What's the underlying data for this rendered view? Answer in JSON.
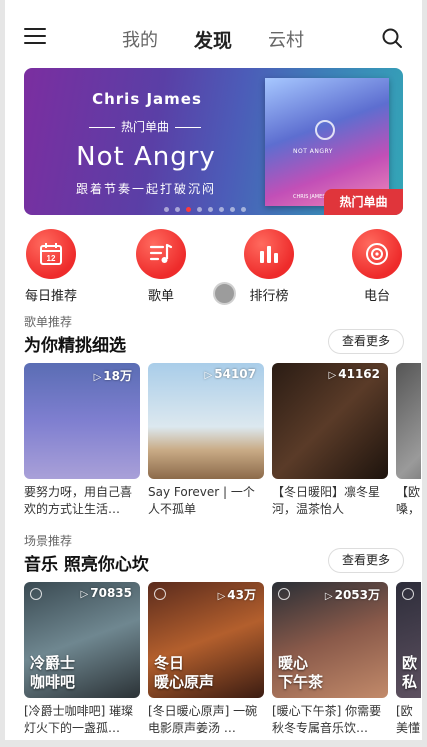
{
  "header": {
    "tabs": [
      {
        "label": "我的",
        "active": false
      },
      {
        "label": "发现",
        "active": true
      },
      {
        "label": "云村",
        "active": false
      }
    ],
    "menu_icon": "hamburger-icon",
    "search_icon": "search-icon"
  },
  "banner": {
    "artist": "Chris James",
    "subtitle": "热门单曲",
    "title": "Not Angry",
    "caption": "跟着节奏一起打破沉闷",
    "badge": "热门单曲",
    "art_label": "NOT ANGRY",
    "art_footer": "CHRIS JAMES",
    "dots_total": 8,
    "dots_active": 2
  },
  "quick_nav": [
    {
      "label": "每日推荐",
      "icon": "calendar-icon",
      "day": "12"
    },
    {
      "label": "歌单",
      "icon": "playlist-icon"
    },
    {
      "label": "排行榜",
      "icon": "chart-bars-icon"
    },
    {
      "label": "电台",
      "icon": "radio-icon"
    }
  ],
  "playlist_section": {
    "small": "歌单推荐",
    "title": "为你精挑细选",
    "more": "查看更多",
    "cards": [
      {
        "count": "18万",
        "desc": "要努力呀，用自己喜欢的方式让生活…"
      },
      {
        "count": "54107",
        "desc": "Say Forever | 一个人不孤单"
      },
      {
        "count": "41162",
        "desc": "【冬日暖阳】凛冬星河，温茶怡人"
      },
      {
        "count": "",
        "desc": "【欧嗓，"
      }
    ]
  },
  "scene_section": {
    "small": "场景推荐",
    "title": "音乐 照亮你心坎",
    "more": "查看更多",
    "cards": [
      {
        "count": "70835",
        "overlay": "冷爵士\n咖啡吧",
        "desc": "[冷爵士咖啡吧] 璀璨灯火下的一盏孤…"
      },
      {
        "count": "43万",
        "overlay": "冬日\n暖心原声",
        "desc": "[冬日暖心原声] 一碗电影原声姜汤 …"
      },
      {
        "count": "2053万",
        "overlay": "暖心\n下午茶",
        "desc": "[暖心下午茶] 你需要秋冬专属音乐饮…"
      },
      {
        "count": "",
        "overlay": "欧\n私",
        "desc": "[欧美懂你"
      }
    ]
  },
  "colors": {
    "accent": "#ee2b2b",
    "badge": "#e0353b"
  }
}
